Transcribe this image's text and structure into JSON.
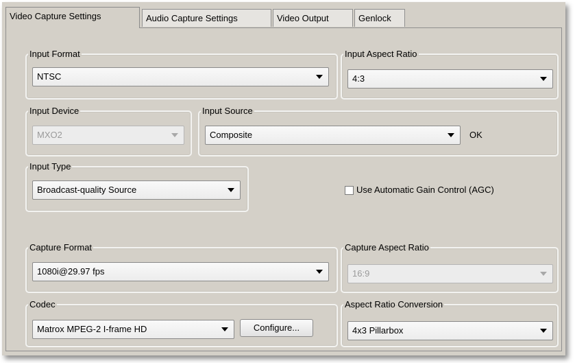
{
  "tabs": [
    {
      "label": "Video Capture Settings",
      "active": true
    },
    {
      "label": "Audio Capture Settings",
      "active": false
    },
    {
      "label": "Video Output",
      "active": false
    },
    {
      "label": "Genlock",
      "active": false
    }
  ],
  "input_format": {
    "legend": "Input Format",
    "value": "NTSC"
  },
  "input_aspect_ratio": {
    "legend": "Input Aspect Ratio",
    "value": "4:3"
  },
  "input_device": {
    "legend": "Input Device",
    "value": "MXO2",
    "enabled": false
  },
  "input_source": {
    "legend": "Input Source",
    "value": "Composite",
    "status": "OK"
  },
  "input_type": {
    "legend": "Input Type",
    "value": "Broadcast-quality Source"
  },
  "agc": {
    "label": "Use Automatic Gain Control (AGC)",
    "checked": false
  },
  "capture_format": {
    "legend": "Capture Format",
    "value": "1080i@29.97 fps"
  },
  "capture_aspect_ratio": {
    "legend": "Capture Aspect Ratio",
    "value": "16:9",
    "enabled": false
  },
  "codec": {
    "legend": "Codec",
    "value": "Matrox MPEG-2 I-frame HD",
    "configure_label": "Configure..."
  },
  "aspect_ratio_conversion": {
    "legend": "Aspect Ratio Conversion",
    "value": "4x3 Pillarbox"
  },
  "icons": {
    "dropdown": "chevron-down-icon",
    "checkbox": "checkbox-icon"
  }
}
